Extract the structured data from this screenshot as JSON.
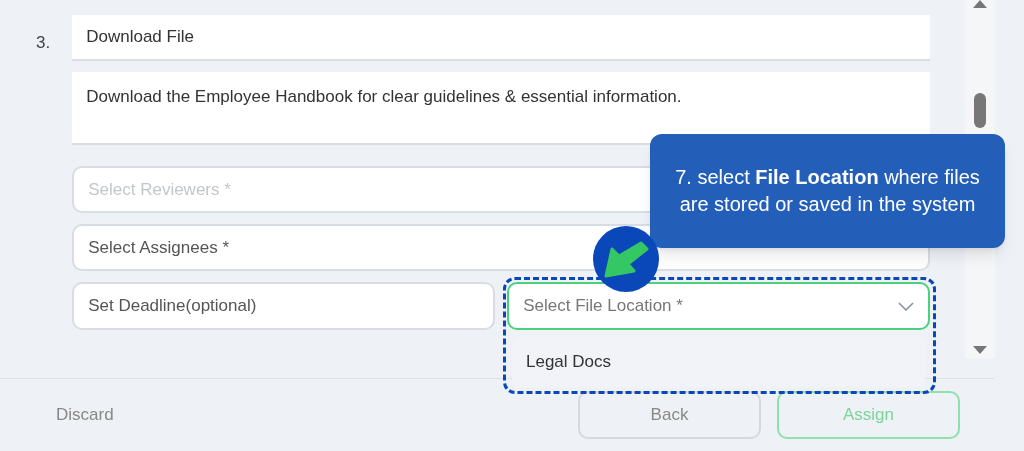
{
  "step": {
    "number": "3.",
    "title_value": "Download File",
    "description_value": "Download the Employee Handbook for clear guidelines & essential information.",
    "fields": [
      {
        "placeholder": "Select Reviewers *",
        "disabled": true
      },
      {
        "placeholder": "Select Assignees *",
        "disabled": false
      }
    ],
    "deadline": {
      "placeholder": "Set Deadline(optional)"
    },
    "file_location": {
      "placeholder": "Select File Location *",
      "focused": true,
      "options": [
        {
          "label": "Legal Docs",
          "selected": false
        }
      ]
    }
  },
  "tooltip": {
    "text": "7. select **File Location** where files are stored or saved in the system"
  },
  "footer": {
    "buttons": [
      {
        "label": "Discard",
        "kind": "text"
      },
      {
        "label": "Back",
        "kind": "outline"
      },
      {
        "label": "Assign",
        "kind": "primary"
      }
    ]
  }
}
